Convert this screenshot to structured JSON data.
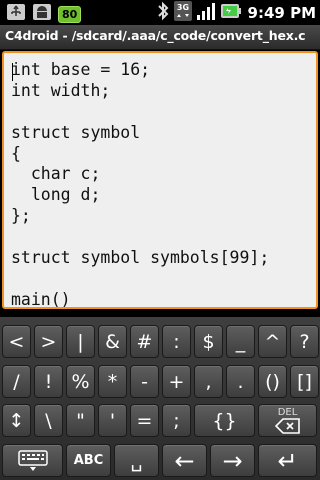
{
  "status_bar": {
    "icons": [
      "usb-icon",
      "android-debug-icon",
      "bluetooth-icon",
      "3g-signal-icon",
      "signal-bars-icon",
      "battery-icon"
    ],
    "battery_badge": "80",
    "network_type": "3G",
    "time": "9:49 PM"
  },
  "title": "C4droid - /sdcard/.aaa/c_code/convert_hex.c",
  "editor": {
    "lines": [
      "int base = 16;",
      "int width;",
      "",
      "struct symbol",
      "{",
      "  char c;",
      "  long d;",
      "};",
      "",
      "struct symbol symbols[99];",
      "",
      "main()"
    ]
  },
  "keyboard": {
    "row1": [
      "<",
      ">",
      "|",
      "&",
      "#",
      ":",
      "$",
      "_",
      "^",
      "?"
    ],
    "row2": [
      "/",
      "!",
      "%",
      "*",
      "-",
      "+",
      ",",
      ".",
      "()",
      "[]"
    ],
    "row3": [
      "↕",
      "\\",
      "\"",
      "'",
      "=",
      ";",
      "{}",
      "DEL"
    ],
    "row4": [
      "keyboard",
      "ABC",
      "␣",
      "←",
      "→",
      "↵"
    ],
    "accent_color": "#f0921e"
  }
}
